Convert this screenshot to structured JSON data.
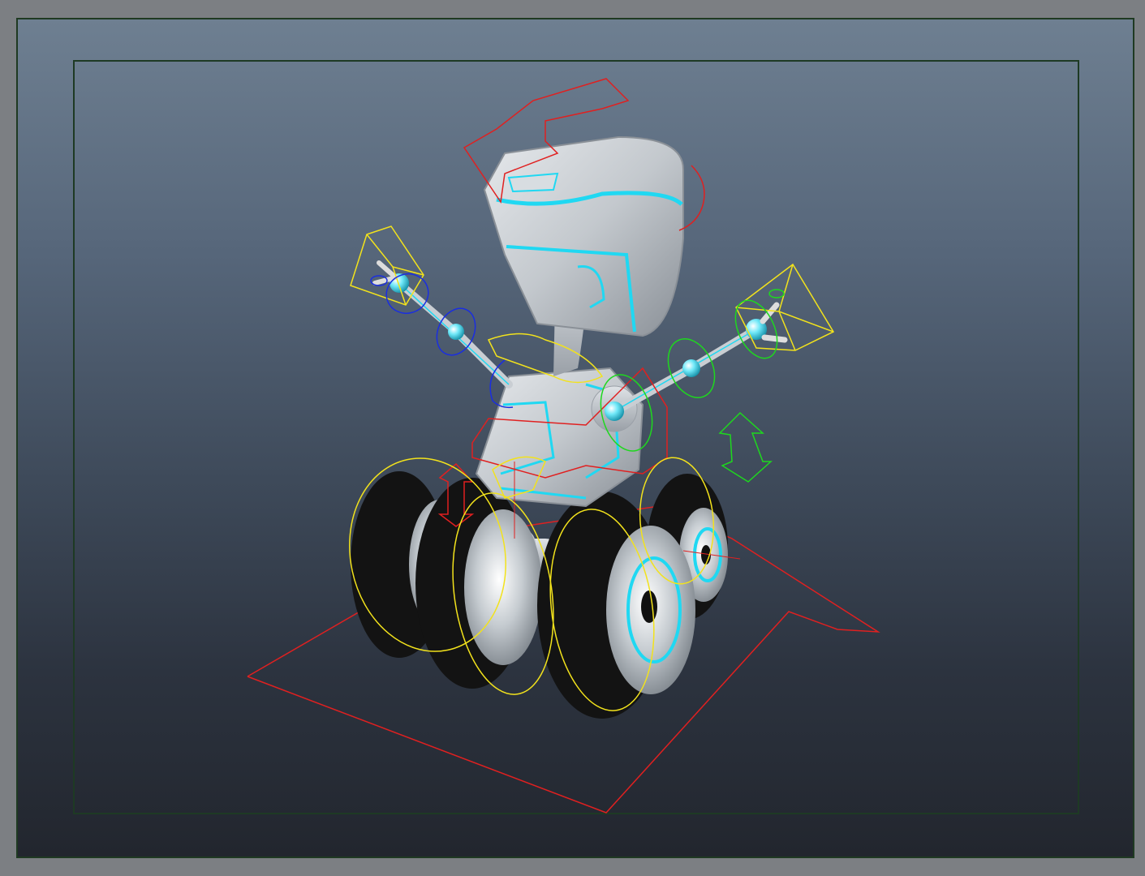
{
  "viewport": {
    "background_top": "#6e7f91",
    "background_bottom": "#22262e",
    "frame_color": "#1e3a24"
  },
  "scene": {
    "subject": "robot-rig",
    "colors": {
      "body": "#c9ced3",
      "body_shadow": "#8d949b",
      "glow": "#20d8f2",
      "tire": "#141414",
      "ctrl_red": "#e02020",
      "ctrl_yellow": "#f2e21c",
      "ctrl_blue": "#1a2ee0",
      "ctrl_green": "#1ed81e"
    }
  }
}
